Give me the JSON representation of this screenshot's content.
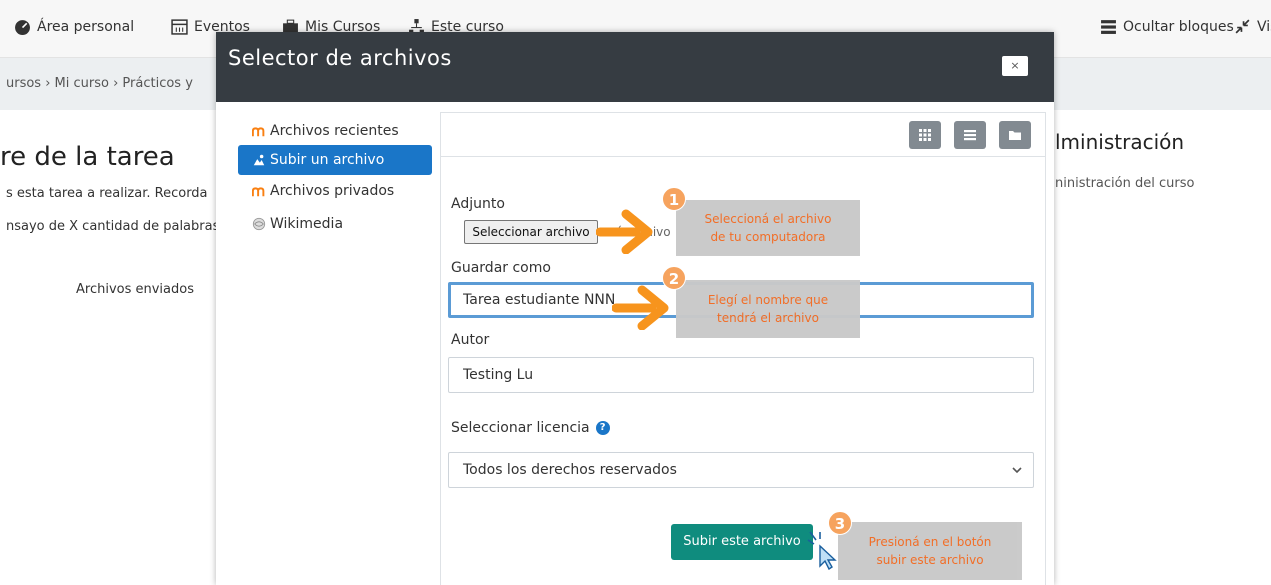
{
  "navbar": {
    "items": [
      {
        "label": "Área personal",
        "icon": "tachometer-icon"
      },
      {
        "label": "Eventos",
        "icon": "calendar-icon"
      },
      {
        "label": "Mis Cursos",
        "icon": "briefcase-icon"
      },
      {
        "label": "Este curso",
        "icon": "sitemap-icon"
      }
    ],
    "hide_blocks": "Ocultar bloques",
    "fullscreen": "Vis"
  },
  "breadcrumb": "ursos  ›  Mi curso  ›  Prácticos y",
  "background": {
    "title": "re de la tarea",
    "text1": "s esta tarea a realizar. Recorda",
    "text2": "nsayo de X cantidad de palabras",
    "submitted": "Archivos enviados",
    "admin_title": "lministración",
    "admin_link": "ninistración del curso"
  },
  "modal": {
    "title": "Selector de archivos",
    "close": "×",
    "repos": [
      {
        "label": "Archivos recientes",
        "icon": "moodle-icon",
        "active": false
      },
      {
        "label": "Subir un archivo",
        "icon": "upload-icon",
        "active": true
      },
      {
        "label": "Archivos privados",
        "icon": "moodle-icon",
        "active": false
      },
      {
        "label": "Wikimedia",
        "icon": "wikimedia-icon",
        "active": false
      }
    ],
    "form": {
      "attachment_label": "Adjunto",
      "file_button": "Seleccionar archivo",
      "file_status": "...ó archivo",
      "save_as_label": "Guardar como",
      "save_as_value": "Tarea estudiante NNN",
      "author_label": "Autor",
      "author_value": "Testing Lu",
      "license_label": "Seleccionar licencia",
      "license_value": "Todos los derechos reservados",
      "upload_button": "Subir este archivo"
    }
  },
  "annotations": [
    {
      "number": "1",
      "text_line1": "Seleccioná el archivo",
      "text_line2": "de tu computadora"
    },
    {
      "number": "2",
      "text_line1": "Elegí el nombre que",
      "text_line2": "tendrá el archivo"
    },
    {
      "number": "3",
      "text_line1": "Presioná en el botón",
      "text_line2": "subir este archivo"
    }
  ],
  "colors": {
    "modal_header": "#363c42",
    "active_repo": "#1a76c8",
    "upload_button": "#0f8c7e",
    "annotation_text": "#f26a21",
    "annotation_arrow": "#f7941d"
  }
}
